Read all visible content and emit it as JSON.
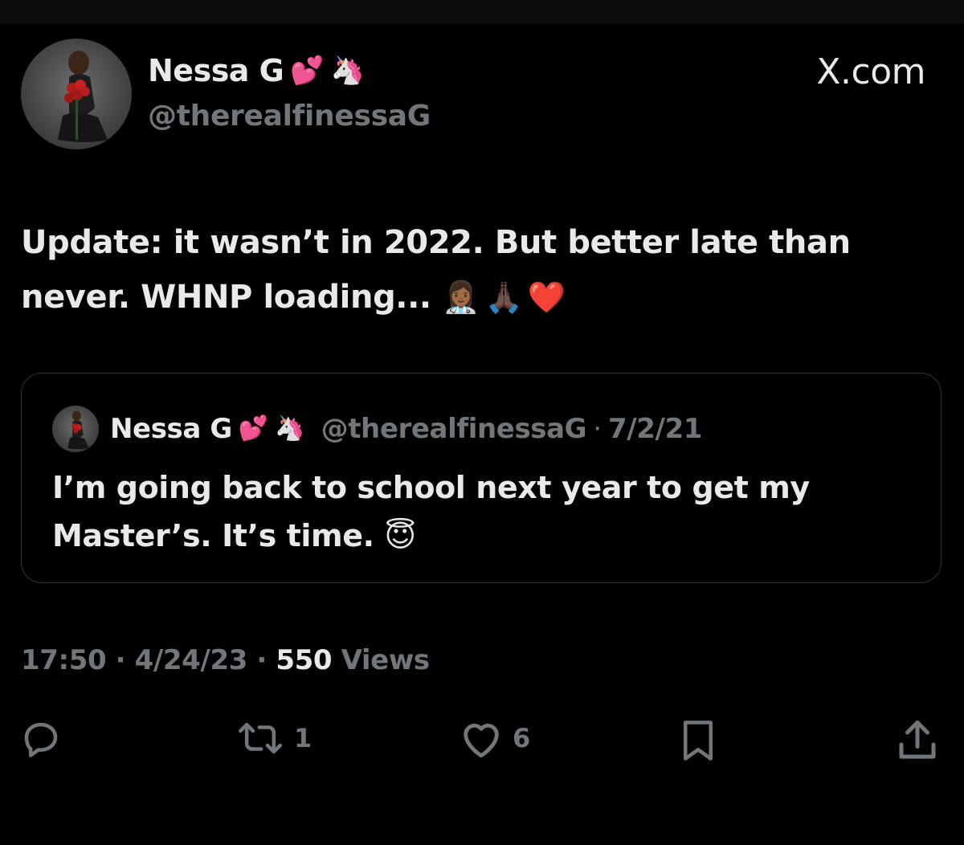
{
  "author": {
    "name": "Nessa G",
    "name_emojis": [
      "💕",
      "🦄"
    ],
    "handle": "@therealfinessaG"
  },
  "source_label": "X.com",
  "tweet": {
    "text": "Update: it wasn’t in 2022. But better late than never. WHNP loading...",
    "emojis": "👩🏾‍⚕️🙏🏿❤️"
  },
  "quoted": {
    "name": "Nessa G",
    "name_emojis": [
      "💕",
      "🦄"
    ],
    "handle": "@therealfinessaG",
    "separator": "·",
    "date": "7/2/21",
    "text": "I’m going back to school next year to get my Master’s. It’s time.",
    "emoji": "😇"
  },
  "meta": {
    "time": "17:50",
    "separator": "·",
    "date": "4/24/23",
    "views_count": "550",
    "views_label": "Views"
  },
  "actions": {
    "reply_icon": "reply-icon",
    "repost_icon": "repost-icon",
    "repost_count": "1",
    "like_icon": "heart-icon",
    "like_count": "6",
    "bookmark_icon": "bookmark-icon",
    "share_icon": "share-icon"
  },
  "colors": {
    "background": "#000000",
    "primary_text": "#e7e9ea",
    "secondary_text": "#71767b",
    "border": "#2f3336"
  }
}
